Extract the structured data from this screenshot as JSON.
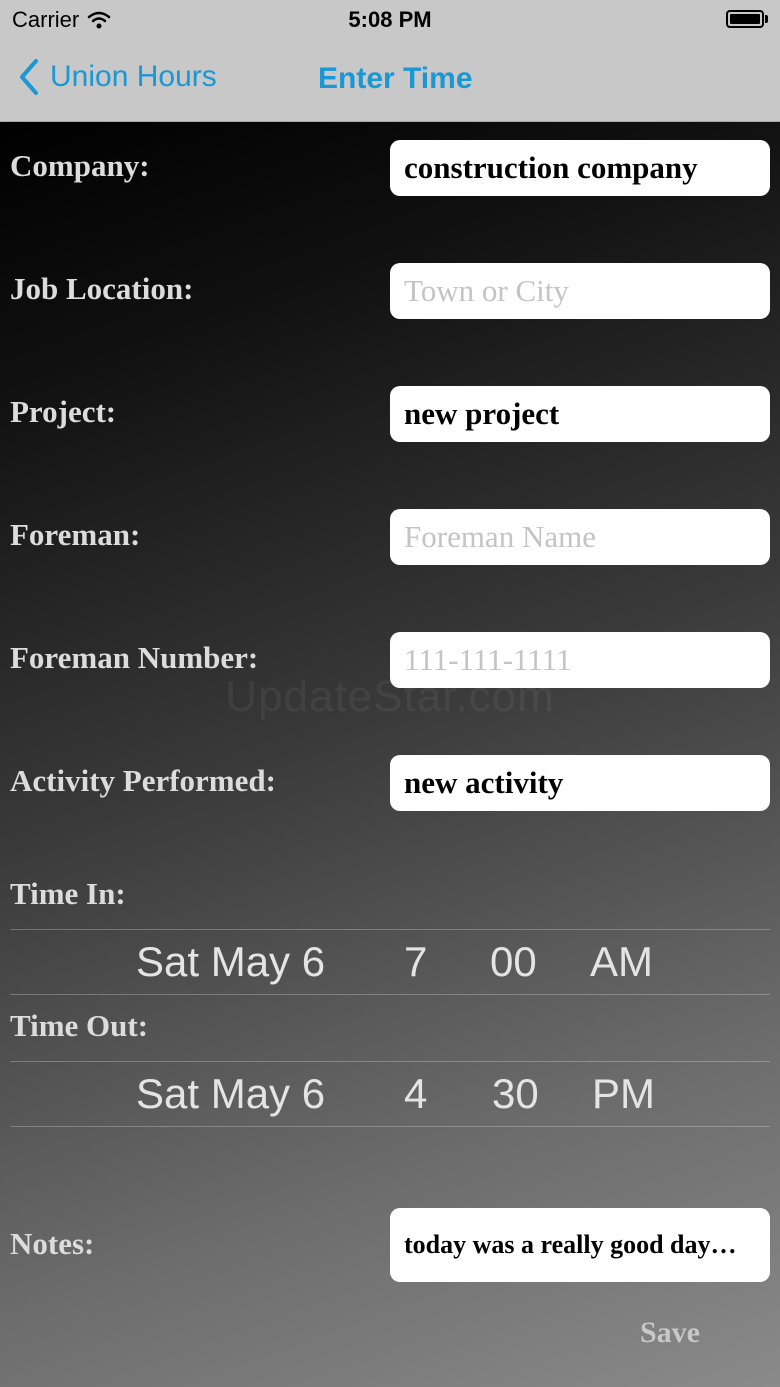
{
  "status_bar": {
    "carrier": "Carrier",
    "time": "5:08 PM"
  },
  "nav": {
    "back_label": "Union Hours",
    "title": "Enter Time"
  },
  "form": {
    "company": {
      "label": "Company:",
      "value": "construction company"
    },
    "job_location": {
      "label": "Job Location:",
      "placeholder": "Town or City"
    },
    "project": {
      "label": "Project:",
      "value": "new project"
    },
    "foreman": {
      "label": "Foreman:",
      "placeholder": "Foreman Name"
    },
    "foreman_number": {
      "label": "Foreman Number:",
      "placeholder": "111-111-1111"
    },
    "activity": {
      "label": "Activity Performed:",
      "value": "new activity"
    },
    "time_in": {
      "label": "Time In:",
      "date": "Sat May 6",
      "hour": "7",
      "minute": "00",
      "ampm": "AM"
    },
    "time_out": {
      "label": "Time Out:",
      "date": "Sat May 6",
      "hour": "4",
      "minute": "30",
      "ampm": "PM"
    },
    "notes": {
      "label": "Notes:",
      "value": "today was a really good day…"
    },
    "save_label": "Save"
  },
  "watermark": "UpdateStar.com",
  "colors": {
    "accent": "#1a97d5",
    "nav_background": "#c8c8c8"
  }
}
